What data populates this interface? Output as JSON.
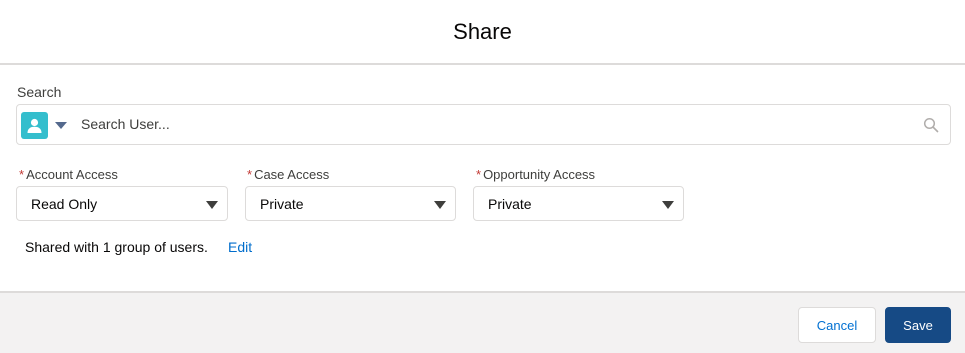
{
  "header": {
    "title": "Share"
  },
  "search": {
    "label": "Search",
    "placeholder": "Search User...",
    "entity_icon": "user-icon"
  },
  "fields": [
    {
      "label": "Account Access",
      "required": "*",
      "value": "Read Only"
    },
    {
      "label": "Case Access",
      "required": "*",
      "value": "Private"
    },
    {
      "label": "Opportunity Access",
      "required": "*",
      "value": "Private"
    }
  ],
  "shared": {
    "text": "Shared with 1 group of users.",
    "edit_label": "Edit"
  },
  "footer": {
    "cancel_label": "Cancel",
    "save_label": "Save"
  },
  "colors": {
    "brand": "#164a85",
    "link": "#006dcc",
    "user_icon": "#34becd",
    "required": "#c23934"
  }
}
